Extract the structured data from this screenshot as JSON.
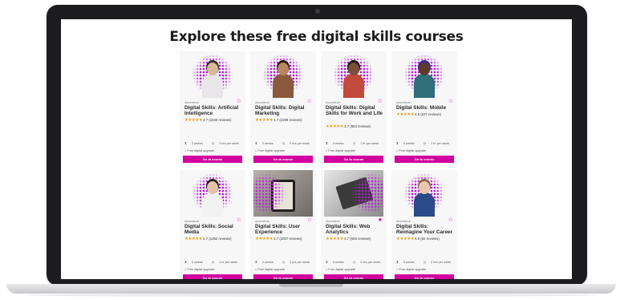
{
  "page": {
    "title": "Explore these free digital skills courses"
  },
  "colors": {
    "accent": "#d1009e",
    "star": "#e6a21a",
    "dots": "#b01fd0"
  },
  "courses": [
    {
      "provider": "Accenture",
      "title": "Digital Skills: Artificial Intelligence",
      "rating": "4.7 (1040 reviews)",
      "weeks": "3 weeks",
      "hours": "2 hrs per week",
      "upgrade": "Free digital upgrade",
      "button": "Go to course",
      "fav_icon": "star-outline-icon"
    },
    {
      "provider": "Accenture",
      "title": "Digital Skills: Digital Marketing",
      "rating": "4.7 (2299 reviews)",
      "weeks": "3 weeks",
      "hours": "2 hrs per week",
      "upgrade": "Free digital upgrade",
      "button": "Go to course",
      "fav_icon": "star-outline-icon"
    },
    {
      "provider": "Accenture",
      "title": "Digital Skills: Digital Skills for Work and Life",
      "rating": "4.7 (804 reviews)",
      "weeks": "3 weeks",
      "hours": "1 hr per week",
      "upgrade": "Free digital upgrade",
      "button": "Go to course",
      "fav_icon": "star-outline-icon"
    },
    {
      "provider": "Accenture",
      "title": "Digital Skills: Mobile",
      "rating": "4.6 (227 reviews)",
      "weeks": "3 weeks",
      "hours": "1 hr per week",
      "upgrade": "Free digital upgrade",
      "button": "Go to course",
      "fav_icon": "star-outline-icon"
    },
    {
      "provider": "Accenture",
      "title": "Digital Skills: Social Media",
      "rating": "4.7 (1352 reviews)",
      "weeks": "3 weeks",
      "hours": "1 hr per week",
      "upgrade": "Free digital upgrade",
      "button": "Go to course",
      "fav_icon": "star-outline-icon"
    },
    {
      "provider": "Accenture",
      "title": "Digital Skills: User Experience",
      "rating": "4.7 (1007 reviews)",
      "weeks": "3 weeks",
      "hours": "2 hrs per week",
      "upgrade": "Free digital upgrade",
      "button": "Go to course",
      "fav_icon": "star-outline-icon"
    },
    {
      "provider": "Accenture",
      "title": "Digital Skills: Web Analytics",
      "rating": "4.7 (603 reviews)",
      "weeks": "3 weeks",
      "hours": "2 hrs per week",
      "upgrade": "Free digital upgrade",
      "button": "Go to course",
      "fav_icon": "star-filled-icon"
    },
    {
      "provider": "Accenture",
      "title": "Digital Skills: Reimagine Your Career",
      "rating": "4.8 (82 reviews)",
      "weeks": "3 weeks",
      "hours": "2 hrs per week",
      "upgrade": "Free digital upgrade",
      "button": "Go to course",
      "fav_icon": "star-outline-icon"
    }
  ]
}
